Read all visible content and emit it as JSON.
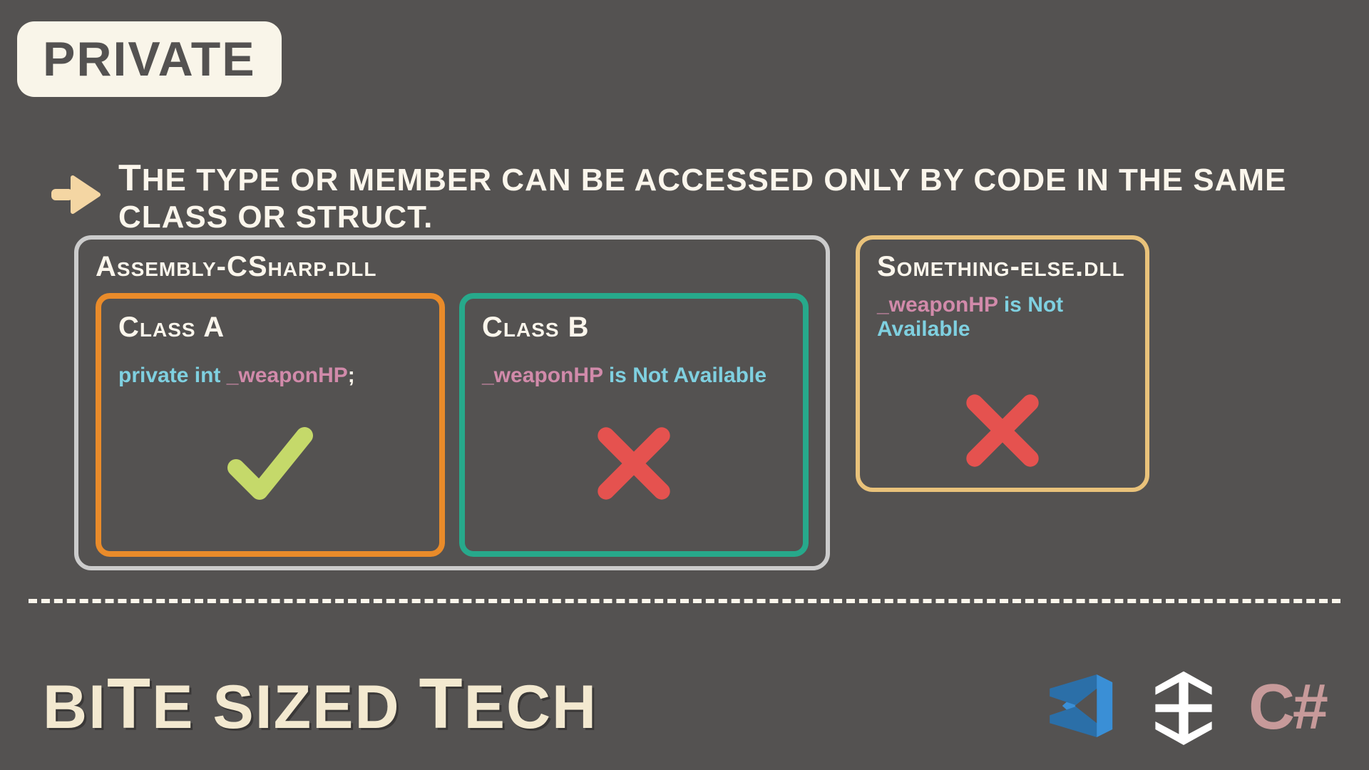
{
  "title": "PRIVATE",
  "description": "The type or member can be accessed only by code in the same class or struct.",
  "assembly_main": {
    "label": "Assembly-CSharp.dll",
    "class_a": {
      "label": "Class A",
      "decl_keyword": "private",
      "decl_type": "int",
      "decl_name": "_weaponHP",
      "decl_semicolon": ";"
    },
    "class_b": {
      "label": "Class B",
      "var_name": "_weaponHP",
      "status_text": " is Not Available"
    }
  },
  "assembly_secondary": {
    "label": "Something-else.dll",
    "var_name": "_weaponHP",
    "status_text": " is Not Available"
  },
  "footer": {
    "brand_part1": "BI",
    "brand_part2": "T",
    "brand_part3": "E SIZED ",
    "brand_part4": "T",
    "brand_part5": "ECH",
    "csharp": "C#"
  },
  "colors": {
    "bg": "#545251",
    "cream": "#f9f5e9",
    "border_gray": "#cccccc",
    "border_yellow": "#e9c27a",
    "border_orange": "#e98b2a",
    "border_teal": "#27a98b",
    "check": "#c5d96a",
    "cross": "#e5524f",
    "vscode": "#3a8fd6",
    "unity": "#ffffff",
    "csharp": "#c79a9a"
  }
}
